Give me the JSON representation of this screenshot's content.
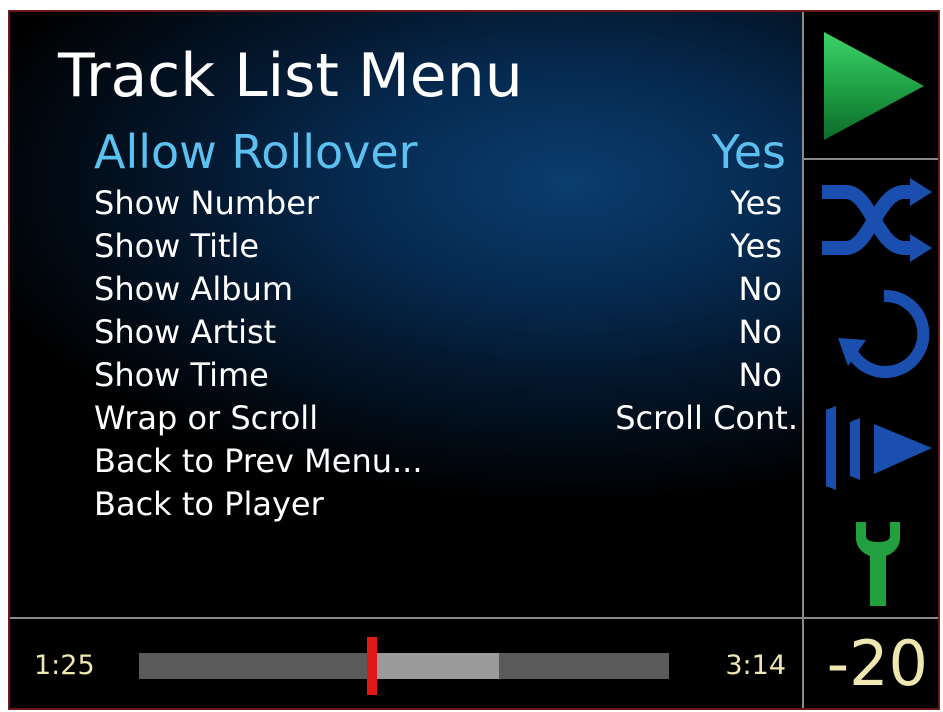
{
  "menu": {
    "title": "Track List Menu",
    "items": [
      {
        "label": "Allow Rollover",
        "value": "Yes"
      },
      {
        "label": "Show Number",
        "value": "Yes"
      },
      {
        "label": "Show Title",
        "value": "Yes"
      },
      {
        "label": "Show Album",
        "value": "No"
      },
      {
        "label": "Show Artist",
        "value": "No"
      },
      {
        "label": "Show Time",
        "value": "No"
      },
      {
        "label": "Wrap or Scroll",
        "value": "Scroll Cont."
      },
      {
        "label": "Back to Prev Menu...",
        "value": ""
      },
      {
        "label": "Back to Player",
        "value": ""
      }
    ]
  },
  "player": {
    "elapsed": "1:25",
    "total": "3:14",
    "progress_fraction": 0.44,
    "buffer_fraction": 0.68,
    "volume": "-20"
  },
  "side_icons": [
    "play-icon",
    "shuffle-icon",
    "repeat-icon",
    "skip-icon",
    "wrench-icon"
  ],
  "colors": {
    "selected_text": "#5cc0f0",
    "time_text": "#efe7b0",
    "progress_marker": "#e01818",
    "play_icon": "#22b04a",
    "side_icons": "#1a4fb0",
    "wrench_icon": "#22a040"
  }
}
